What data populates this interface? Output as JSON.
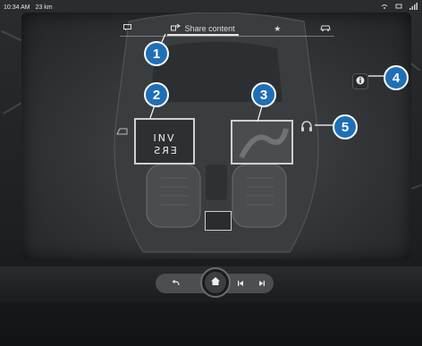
{
  "status_bar": {
    "time": "10:34 AM",
    "range": "23 km",
    "icons": [
      "wireless-icon",
      "connectivity-icon",
      "signal-icon"
    ]
  },
  "tabs": {
    "items": [
      {
        "name": "chat-icon",
        "label": ""
      },
      {
        "name": "share-content-tab",
        "label": "Share content",
        "icon": "share-arrow-icon",
        "active": true
      },
      {
        "name": "favorites-tab",
        "label": "★"
      },
      {
        "name": "settings-tab",
        "label": "",
        "icon": "car-settings-icon"
      }
    ]
  },
  "screens": {
    "front_label_top": "INV",
    "front_label_bottom": "ERS"
  },
  "callouts": [
    "1",
    "2",
    "3",
    "4",
    "5"
  ],
  "controls": {
    "back_icon": "back-icon",
    "home_icon": "home-icon",
    "prev_icon": "previous-track-icon",
    "next_icon": "next-track-icon"
  },
  "colors": {
    "callout_fill": "#1f6fb6",
    "callout_border": "#ffffff"
  }
}
